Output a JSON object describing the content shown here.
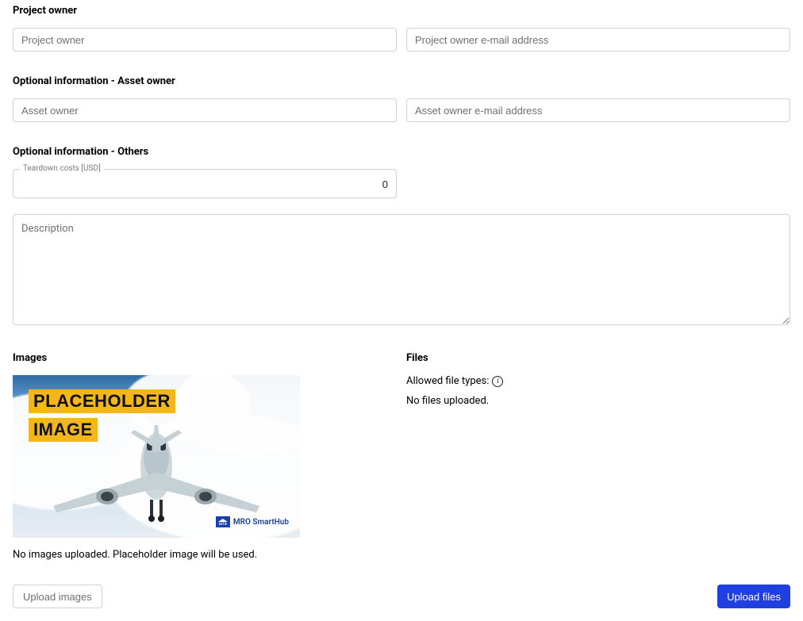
{
  "sections": {
    "project_owner": {
      "heading": "Project owner",
      "owner_placeholder": "Project owner",
      "email_placeholder": "Project owner e-mail address"
    },
    "asset_owner": {
      "heading": "Optional information - Asset owner",
      "owner_placeholder": "Asset owner",
      "email_placeholder": "Asset owner e-mail address"
    },
    "others": {
      "heading": "Optional information - Others",
      "teardown_label": "Teardown costs [USD]",
      "teardown_value": "0",
      "description_placeholder": "Description"
    }
  },
  "images": {
    "heading": "Images",
    "placeholder_line1": "PLACEHOLDER",
    "placeholder_line2": "IMAGE",
    "brand": "MRO SmartHub",
    "caption": "No images uploaded. Placeholder image will be used.",
    "upload_btn": "Upload images"
  },
  "files": {
    "heading": "Files",
    "allowed_label": "Allowed file types:",
    "none_text": "No files uploaded.",
    "upload_btn": "Upload files"
  }
}
